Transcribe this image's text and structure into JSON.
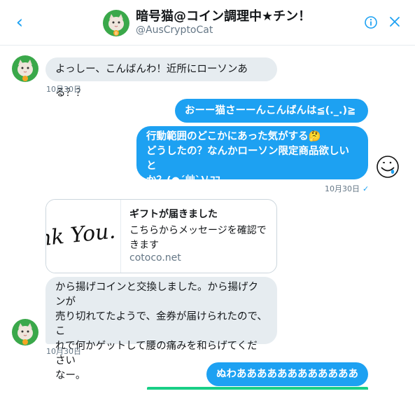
{
  "header": {
    "back_icon": "chevron-left",
    "title": "暗号猫@コイン調理中★チン！",
    "handle": "@AusCryptoCat",
    "info_icon": "info-circle",
    "close_icon": "close-x"
  },
  "colors": {
    "accent": "#1da1f2",
    "incoming_bubble": "#e6ecf0",
    "avatar_bg": "#3aa84a"
  },
  "messages": [
    {
      "direction": "in",
      "text": "よっしー、こんばんわ！近所にローソンある？？",
      "timestamp": "10月30日"
    },
    {
      "direction": "out",
      "text": "おーー猫さーーんこんばんは≦(._.)≧ﾍﾟｺ"
    },
    {
      "direction": "out",
      "lines": [
        "行動範囲のどこかにあった気がする🤔",
        "どうしたの？なんかローソン限定商品欲しいと",
        "か？(●´艸`)ﾑﾌﾌ"
      ],
      "timestamp": "10月30日",
      "status_icon": "check-mark"
    },
    {
      "direction": "in",
      "type": "card",
      "image_text": "ank You.",
      "title": "ギフトが届きました",
      "description": "こちらからメッセージを確認できます",
      "domain": "cotoco.net"
    },
    {
      "direction": "in",
      "lines": [
        "から揚げコインと交換しました。から揚げクンが",
        "売り切れてたようで、金券が届けられたので、こ",
        "れで何かゲットして腰の痛みを和らげてください",
        "なー。"
      ],
      "timestamp": "10月30日"
    },
    {
      "direction": "out",
      "text": "ぬわああああああああああああああ"
    }
  ],
  "sticker_icon": "smiley-tongue-sticker"
}
